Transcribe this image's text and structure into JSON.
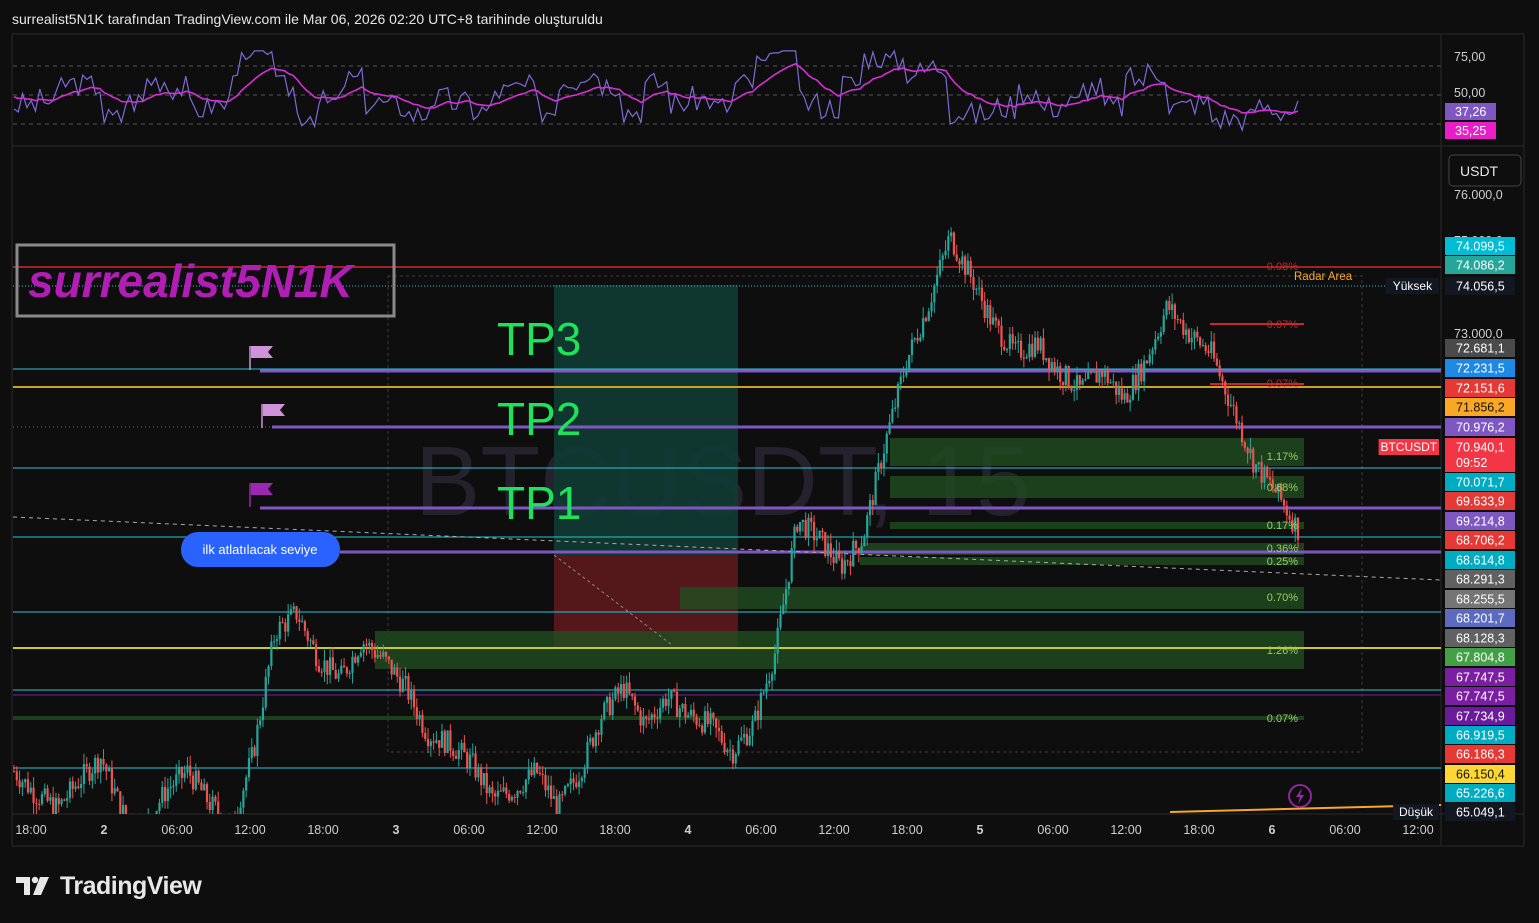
{
  "header": {
    "title": "surrealist5N1K tarafından TradingView.com ile Mar 06, 2026 02:20 UTC+8 tarihinde oluşturuldu"
  },
  "brand": {
    "name": "TradingView"
  },
  "watermark": {
    "symbol": "BTCUSDT, 15"
  },
  "signature": {
    "text": "surrealist5N1K"
  },
  "currency_button": "USDT",
  "rsi": {
    "levels": [
      "75,00",
      "50,00"
    ],
    "badges": [
      {
        "text": "37,26",
        "color": "#7e57c2"
      },
      {
        "text": "35,25",
        "color": "#e91ec9"
      }
    ]
  },
  "chart_data": {
    "type": "line",
    "title": "BTCUSDT, 15",
    "note_interval": "15",
    "y_ticks": [
      "76.000,0",
      "75.000,0",
      "73.000,0"
    ],
    "x_ticks": [
      "18:00",
      "2",
      "06:00",
      "12:00",
      "18:00",
      "3",
      "06:00",
      "12:00",
      "18:00",
      "4",
      "06:00",
      "12:00",
      "18:00",
      "5",
      "06:00",
      "12:00",
      "18:00",
      "6",
      "06:00",
      "12:00"
    ],
    "series": [
      {
        "values": [
          68300,
          68050,
          67900,
          68200,
          68450,
          67850,
          67700,
          68100,
          68300,
          67950,
          67700,
          68500,
          69800,
          70000,
          69500,
          69300,
          69700,
          69500,
          69200,
          68700,
          68600,
          68400,
          68000,
          68100,
          68300,
          67900,
          68300,
          68900,
          69200,
          68800,
          69100,
          68900,
          68800,
          68500,
          68800,
          69600,
          71000,
          70800,
          70500,
          70800,
          71800,
          72700,
          73300,
          74050,
          73600,
          73100,
          72800,
          72900,
          72600,
          72400,
          72600,
          72300,
          72700,
          73300,
          73000,
          72800,
          72200,
          71600,
          71300,
          70900
        ]
      }
    ],
    "ylim": [
      65000,
      76300
    ],
    "tp_labels": [
      "TP3",
      "TP2",
      "TP1"
    ],
    "annotation": "ilk atlatılacak seviye",
    "radar_label": "Radar Area",
    "high_label": "Yüksek",
    "low_label": "Düşük",
    "fib_labels": [
      "0.08%",
      "0.07%",
      "0.07%",
      "1.17%",
      "0.68%",
      "0.17%",
      "0.36%",
      "0.25%",
      "0.70%",
      "1.26%",
      "0.07%"
    ],
    "price_badges": [
      {
        "text": "74.099,5",
        "color": "#00bcd4"
      },
      {
        "text": "74.086,2",
        "color": "#26a69a"
      },
      {
        "text": "74.056,5",
        "color": "#131722",
        "label": "Yüksek"
      },
      {
        "text": "72.681,1",
        "color": "#4a4a4a"
      },
      {
        "text": "72.231,5",
        "color": "#1e88e5"
      },
      {
        "text": "72.151,6",
        "color": "#e53935"
      },
      {
        "text": "71.856,2",
        "color": "#f9a825"
      },
      {
        "text": "70.976,2",
        "color": "#7e57c2"
      },
      {
        "text": "70.940,1",
        "color": "#f23645",
        "label": "BTCUSDT",
        "sub": "09:52"
      },
      {
        "text": "70.071,7",
        "color": "#00acc1"
      },
      {
        "text": "69.633,9",
        "color": "#e53935"
      },
      {
        "text": "69.214,8",
        "color": "#7e57c2"
      },
      {
        "text": "68.706,2",
        "color": "#e53935"
      },
      {
        "text": "68.614,8",
        "color": "#00acc1"
      },
      {
        "text": "68.291,3",
        "color": "#616161"
      },
      {
        "text": "68.255,5",
        "color": "#757575"
      },
      {
        "text": "68.201,7",
        "color": "#5c6bc0"
      },
      {
        "text": "68.128,3",
        "color": "#616161"
      },
      {
        "text": "67.804,8",
        "color": "#43a047"
      },
      {
        "text": "67.747,5",
        "color": "#7b1fa2"
      },
      {
        "text": "67.747,5",
        "color": "#7b1fa2"
      },
      {
        "text": "67.734,9",
        "color": "#6a1b9a"
      },
      {
        "text": "66.919,5",
        "color": "#00acc1"
      },
      {
        "text": "66.186,3",
        "color": "#e53935"
      },
      {
        "text": "66.150,4",
        "color": "#fdd835"
      },
      {
        "text": "65.226,6",
        "color": "#00acc1"
      },
      {
        "text": "65.049,1",
        "color": "#131722",
        "label": "Düşük"
      }
    ]
  }
}
